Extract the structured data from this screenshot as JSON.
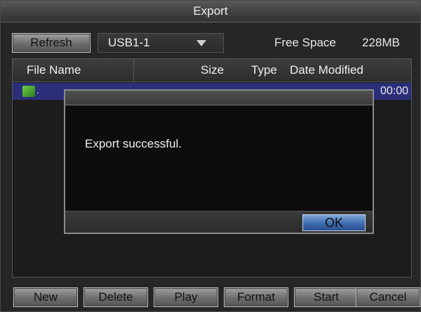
{
  "window": {
    "title": "Export"
  },
  "toolbar": {
    "refresh_label": "Refresh",
    "device_value": "USB1-1",
    "free_space_label": "Free Space",
    "free_space_value": "228MB"
  },
  "table": {
    "columns": [
      "File Name",
      "Size",
      "Type",
      "Date Modified"
    ],
    "rows": [
      {
        "name_fragment": ".",
        "date_fragment": "00:00"
      }
    ]
  },
  "dialog": {
    "message": "Export successful.",
    "ok_label": "OK"
  },
  "actions": [
    "New",
    "Delete",
    "Play",
    "Format",
    "Start",
    "Cancel"
  ],
  "colors": {
    "selection_row": "#2b2f7a",
    "ok_button": "#3e6bb0"
  }
}
